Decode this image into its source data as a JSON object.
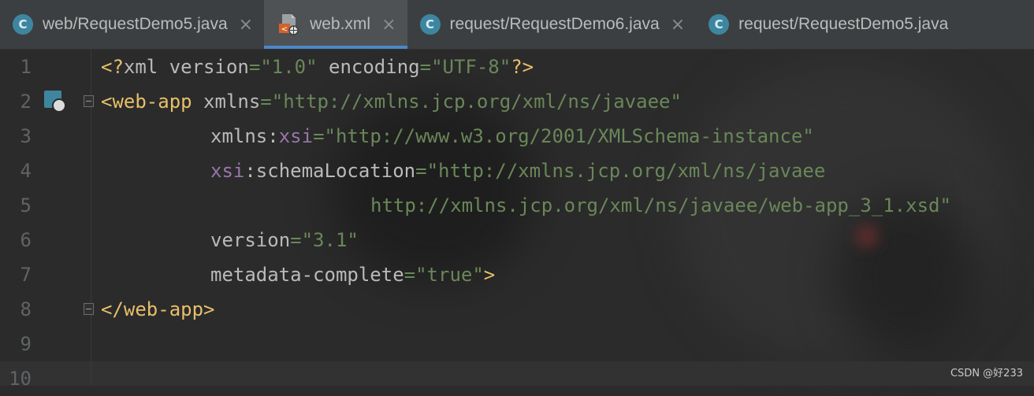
{
  "tabs": [
    {
      "icon": "class-c-icon",
      "label": "web/RequestDemo5.java",
      "close": "×",
      "active": false
    },
    {
      "icon": "xml-file-icon",
      "label": "web.xml",
      "close": "×",
      "active": true
    },
    {
      "icon": "class-c-icon",
      "label": "request/RequestDemo6.java",
      "close": "×",
      "active": false
    },
    {
      "icon": "class-c-icon",
      "label": "request/RequestDemo5.java",
      "close": "",
      "active": false
    }
  ],
  "class_icon_letter": "C",
  "editor": {
    "lines": [
      {
        "num": "1"
      },
      {
        "num": "2"
      },
      {
        "num": "3"
      },
      {
        "num": "4"
      },
      {
        "num": "5"
      },
      {
        "num": "6"
      },
      {
        "num": "7"
      },
      {
        "num": "8"
      },
      {
        "num": "9"
      },
      {
        "num": "10"
      }
    ],
    "tokens": {
      "l1_open": "<?",
      "l1_xml": "xml ",
      "l1_version": "version",
      "l1_eq1": "=",
      "l1_version_val": "\"1.0\"",
      "l1_encoding": " encoding",
      "l1_eq2": "=",
      "l1_encoding_val": "\"UTF-8\"",
      "l1_close": "?>",
      "l2_tag": "<web-app",
      "l2_xmlns": " xmlns",
      "l2_eq": "=",
      "l2_xmlns_val": "\"http://xmlns.jcp.org/xml/ns/javaee\"",
      "l3_xmlns_prefix": "xmlns:",
      "l3_xsi": "xsi",
      "l3_eq": "=",
      "l3_val": "\"http://www.w3.org/2001/XMLSchema-instance\"",
      "l4_xsi": "xsi",
      "l4_schema": ":schemaLocation",
      "l4_eq": "=",
      "l4_val": "\"http://xmlns.jcp.org/xml/ns/javaee",
      "l5_val": "http://xmlns.jcp.org/xml/ns/javaee/web-app_3_1.xsd\"",
      "l6_attr": "version",
      "l6_eq": "=",
      "l6_val": "\"3.1\"",
      "l7_attr": "metadata-complete",
      "l7_eq": "=",
      "l7_val": "\"true\"",
      "l7_close": ">",
      "l8_tag": "</web-app>"
    }
  },
  "watermark": "CSDN @好233",
  "colors": {
    "tag": "#e8bf6a",
    "attribute": "#bababa",
    "namespace": "#9876aa",
    "string": "#6a8759",
    "line_number": "#606366",
    "active_tab_underline": "#4a88c7"
  }
}
